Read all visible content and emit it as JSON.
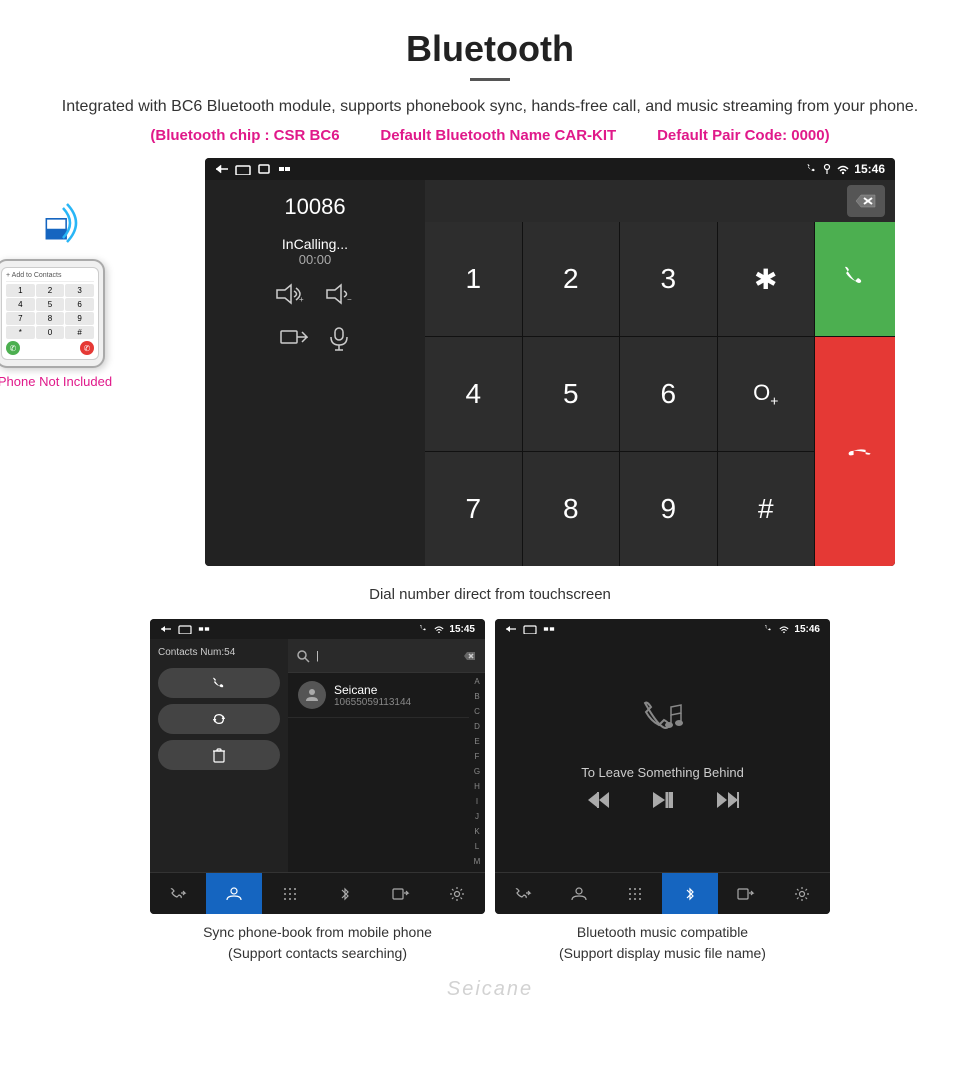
{
  "header": {
    "title": "Bluetooth",
    "description": "Integrated with BC6 Bluetooth module, supports phonebook sync, hands-free call, and music streaming from your phone.",
    "bt_chip": "(Bluetooth chip : CSR BC6",
    "bt_name": "Default Bluetooth Name CAR-KIT",
    "bt_pair": "Default Pair Code: 0000)"
  },
  "main_dial": {
    "status_time": "15:46",
    "dialed_number": "10086",
    "call_status": "InCalling...",
    "call_timer": "00:00",
    "numpad_keys": [
      "1",
      "2",
      "3",
      "*",
      "4",
      "5",
      "6",
      "0+",
      "7",
      "8",
      "9",
      "#"
    ],
    "backspace_symbol": "⌫",
    "green_call_symbol": "📞",
    "red_end_symbol": "📵"
  },
  "caption_dial": "Dial number direct from touchscreen",
  "phone_not_included": "Phone Not Included",
  "contacts_screen": {
    "status_time": "15:45",
    "contacts_count": "Contacts Num:54",
    "contact_name": "Seicane",
    "contact_number": "10655059113144",
    "search_placeholder": "Search",
    "alphabet": [
      "A",
      "B",
      "C",
      "D",
      "E",
      "F",
      "G",
      "H",
      "I",
      "J",
      "K",
      "L",
      "M"
    ]
  },
  "music_screen": {
    "status_time": "15:46",
    "song_name": "To Leave Something Behind"
  },
  "lower_captions": {
    "contacts": "Sync phone-book from mobile phone\n(Support contacts searching)",
    "music": "Bluetooth music compatible\n(Support display music file name)"
  },
  "nav_items": [
    "phone-transfer",
    "contacts",
    "keypad",
    "bluetooth",
    "phone-link",
    "settings"
  ],
  "watermark": "Seicane"
}
